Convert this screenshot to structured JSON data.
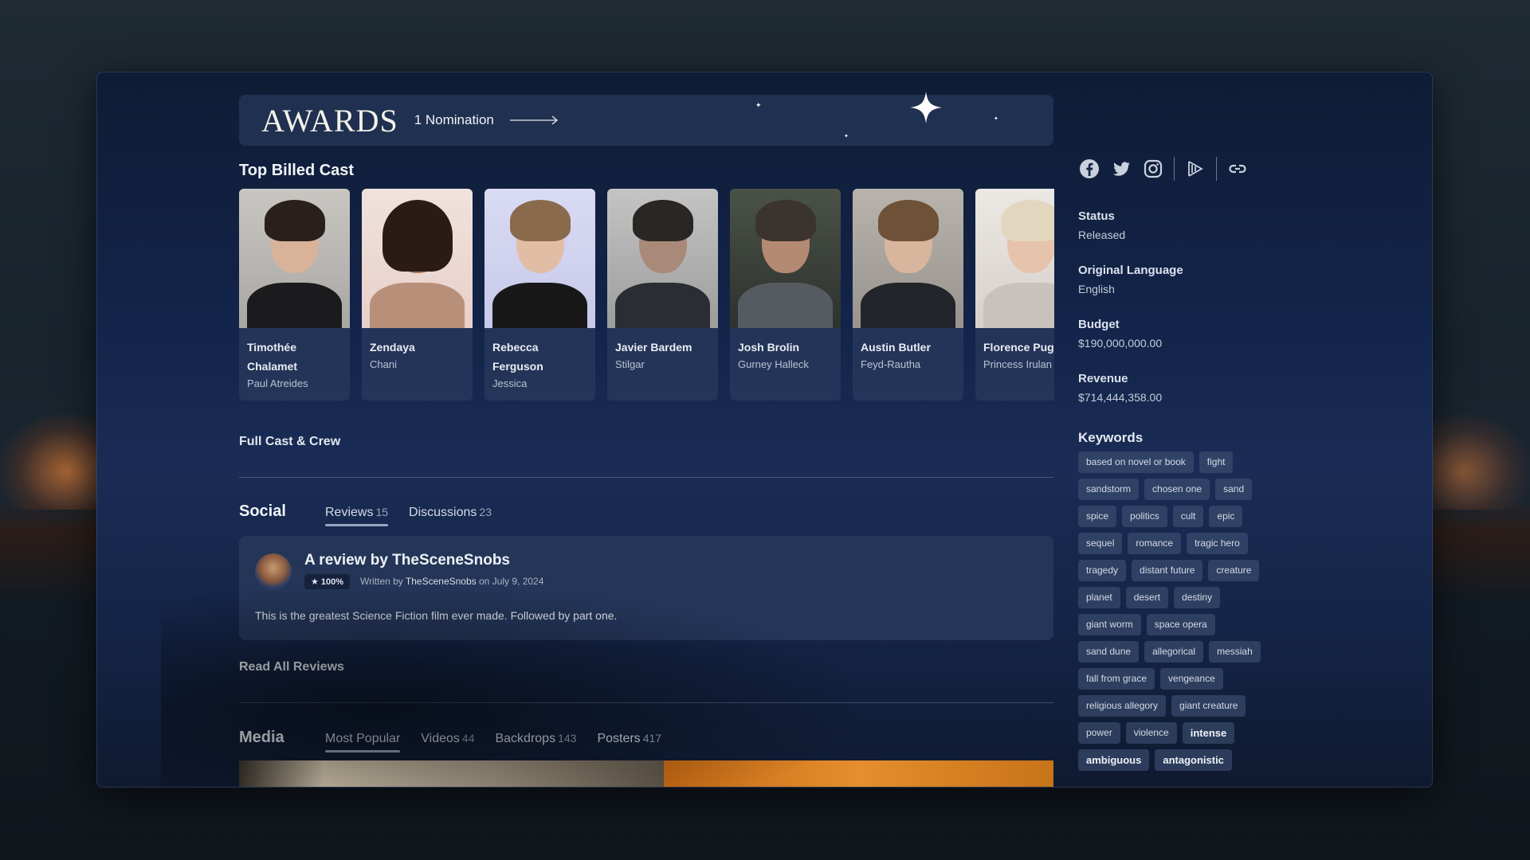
{
  "awards": {
    "title": "AWARDS",
    "nominations": "1 Nomination"
  },
  "cast": {
    "title": "Top Billed Cast",
    "members": [
      {
        "name": "Timothée Chalamet",
        "role": "Paul Atreides"
      },
      {
        "name": "Zendaya",
        "role": "Chani"
      },
      {
        "name": "Rebecca Ferguson",
        "role": "Jessica"
      },
      {
        "name": "Javier Bardem",
        "role": "Stilgar"
      },
      {
        "name": "Josh Brolin",
        "role": "Gurney Halleck"
      },
      {
        "name": "Austin Butler",
        "role": "Feyd-Rautha"
      },
      {
        "name": "Florence Pugh",
        "role": "Princess Irulan"
      }
    ],
    "full_cast_link": "Full Cast & Crew"
  },
  "social": {
    "title": "Social",
    "tabs": [
      {
        "label": "Reviews",
        "count": "15"
      },
      {
        "label": "Discussions",
        "count": "23"
      }
    ],
    "review": {
      "title": "A review by TheSceneSnobs",
      "rating": "★ 100%",
      "written_by_prefix": "Written by",
      "author": "TheSceneSnobs",
      "date_text": "on July 9, 2024",
      "body": "This is the greatest Science Fiction film ever made. Followed by part one."
    },
    "read_all": "Read All Reviews"
  },
  "media": {
    "title": "Media",
    "tabs": [
      {
        "label": "Most Popular",
        "count": ""
      },
      {
        "label": "Videos",
        "count": "44"
      },
      {
        "label": "Backdrops",
        "count": "143"
      },
      {
        "label": "Posters",
        "count": "417"
      }
    ]
  },
  "sidebar": {
    "social_icons": [
      "facebook-icon",
      "twitter-icon",
      "instagram-icon",
      "justwatch-icon",
      "homepage-link-icon"
    ],
    "facts": [
      {
        "label": "Status",
        "value": "Released"
      },
      {
        "label": "Original Language",
        "value": "English"
      },
      {
        "label": "Budget",
        "value": "$190,000,000.00"
      },
      {
        "label": "Revenue",
        "value": "$714,444,358.00"
      }
    ],
    "keywords_title": "Keywords",
    "keywords": [
      "based on novel or book",
      "fight",
      "sandstorm",
      "chosen one",
      "sand",
      "spice",
      "politics",
      "cult",
      "epic",
      "sequel",
      "romance",
      "tragic hero",
      "tragedy",
      "distant future",
      "creature",
      "planet",
      "desert",
      "destiny",
      "giant worm",
      "space opera",
      "sand dune",
      "allegorical",
      "messiah",
      "fall from grace",
      "vengeance",
      "religious allegory",
      "giant creature",
      "power",
      "violence",
      "intense",
      "ambiguous",
      "antagonistic"
    ]
  }
}
